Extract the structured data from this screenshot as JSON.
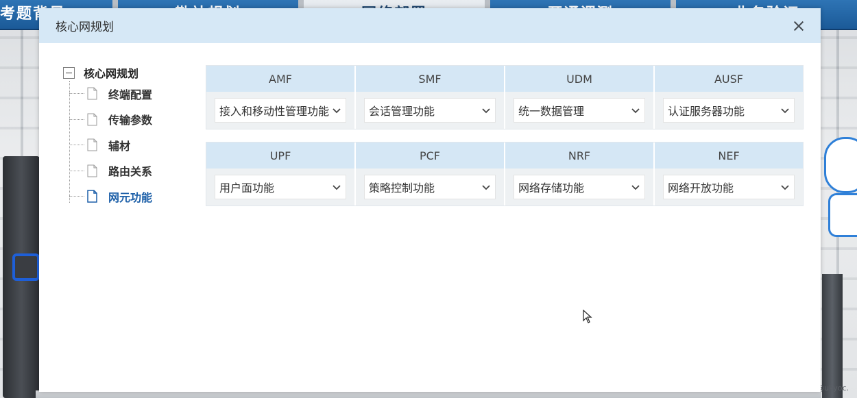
{
  "background": {
    "nav_tabs": [
      "考题背景",
      "勘站规划",
      "网络部署",
      "开通调测",
      "业务验证"
    ],
    "watermark": "CSDN @ukyoc."
  },
  "modal": {
    "title": "核心网规划",
    "tree": {
      "root_label": "核心网规划",
      "items": [
        {
          "label": "终端配置"
        },
        {
          "label": "传输参数"
        },
        {
          "label": "辅材"
        },
        {
          "label": "路由关系"
        },
        {
          "label": "网元功能"
        }
      ]
    },
    "grid_top": {
      "headers": [
        "AMF",
        "SMF",
        "UDM",
        "AUSF"
      ],
      "values": [
        "接入和移动性管理功能",
        "会话管理功能",
        "统一数据管理",
        "认证服务器功能"
      ]
    },
    "grid_bottom": {
      "headers": [
        "UPF",
        "PCF",
        "NRF",
        "NEF"
      ],
      "values": [
        "用户面功能",
        "策略控制功能",
        "网络存储功能",
        "网络开放功能"
      ]
    }
  },
  "colors": {
    "header_bg": "#d6e8f6",
    "active_item": "#1c5fa8",
    "nav_blue": "#2e74b5"
  }
}
